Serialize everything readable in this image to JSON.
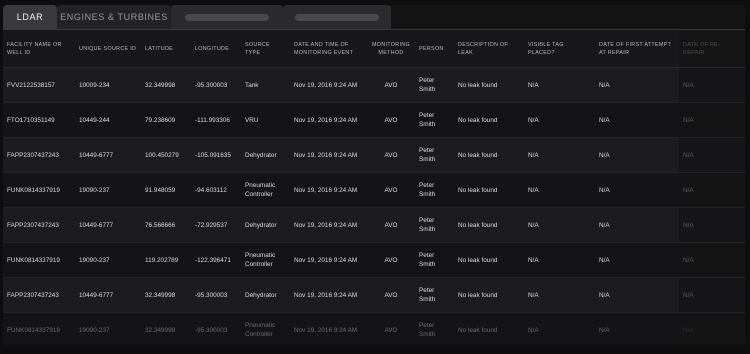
{
  "tabs": [
    {
      "label": "LDAR",
      "active": true
    },
    {
      "label": "ENGINES & TURBINES",
      "active": false
    }
  ],
  "columns": [
    "FACILITY NAME OR WELL ID",
    "UNIQUE SOURCE ID",
    "LATITUDE",
    "LONGITUDE",
    "SOURCE TYPE",
    "DATE AND TIME OF MONITORING EVENT",
    "MONITORING METHOD",
    "PERSON",
    "DESCRIPTION OF LEAK",
    "VISIBLE TAG PLACED?",
    "DATE OF FIRST ATTEMPT AT REPAIR",
    "DATE OF RE-REPAIR"
  ],
  "rows": [
    [
      "FVV2122538157",
      "10009-234",
      "32.349998",
      "-95.300003",
      "Tank",
      "Nov 19, 2016 9:24 AM",
      "AVO",
      "Peter Smith",
      "No leak found",
      "N/A",
      "N/A",
      "N/A"
    ],
    [
      "FTO1710351149",
      "10449-244",
      "79.238609",
      "-111.993306",
      "VRU",
      "Nov 19, 2016 9:24 AM",
      "AVO",
      "Peter Smith",
      "No leak found",
      "N/A",
      "N/A",
      "N/A"
    ],
    [
      "FAPP2307437243",
      "10449-6777",
      "100.450279",
      "-105.091635",
      "Dehydrator",
      "Nov 19, 2016 9:24 AM",
      "AVO",
      "Peter Smith",
      "No leak found",
      "N/A",
      "N/A",
      "N/A"
    ],
    [
      "FUNK0814337919",
      "19090-237",
      "91.948059",
      "-94.603112",
      "Pneumatic Controller",
      "Nov 19, 2016 9:24 AM",
      "AVO",
      "Peter Smith",
      "No leak found",
      "N/A",
      "N/A",
      "N/A"
    ],
    [
      "FAPP2307437243",
      "10449-6777",
      "76.566666",
      "-72.929537",
      "Dehydrator",
      "Nov 19, 2016 9:24 AM",
      "AVO",
      "Peter Smith",
      "No leak found",
      "N/A",
      "N/A",
      "N/A"
    ],
    [
      "FUNK0814337919",
      "19090-237",
      "119.202789",
      "-122.396471",
      "Pneumatic Controller",
      "Nov 19, 2016 9:24 AM",
      "AVO",
      "Peter Smith",
      "No leak found",
      "N/A",
      "N/A",
      "N/A"
    ],
    [
      "FAPP2307437243",
      "10449-6777",
      "32.349998",
      "-95.300003",
      "Dehydrator",
      "Nov 19, 2016 9:24 AM",
      "AVO",
      "Peter Smith",
      "No leak found",
      "N/A",
      "N/A",
      "N/A"
    ],
    [
      "FUNK0814337919",
      "19090-237",
      "32.349998",
      "-95.300003",
      "Pneumatic Controller",
      "Nov 19, 2016 9:24 AM",
      "AVO",
      "Peter Smith",
      "No leak found",
      "N/A",
      "N/A",
      "N/A"
    ]
  ]
}
